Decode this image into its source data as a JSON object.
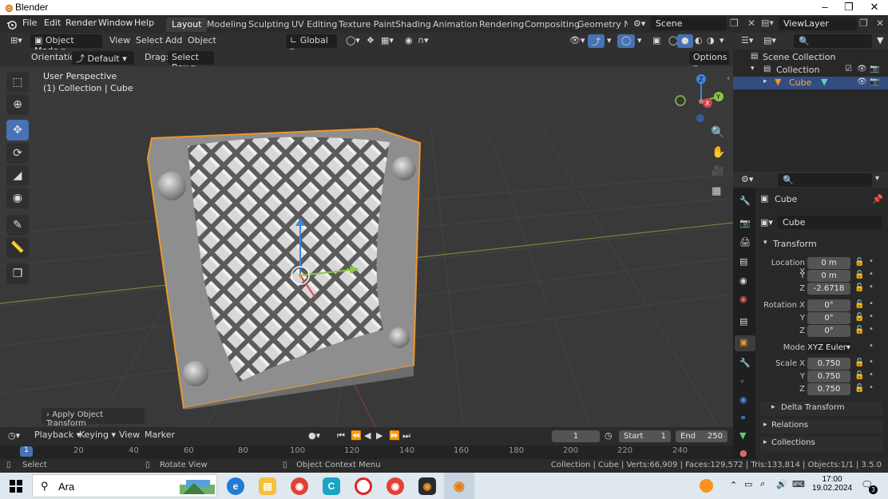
{
  "window": {
    "title": "Blender"
  },
  "menu": {
    "items": [
      "File",
      "Edit",
      "Render",
      "Window",
      "Help"
    ]
  },
  "workspaces": {
    "tabs": [
      "Layout",
      "Modeling",
      "Sculpting",
      "UV Editing",
      "Texture Paint",
      "Shading",
      "Animation",
      "Rendering",
      "Compositing",
      "Geometry Noc"
    ],
    "active": "Layout"
  },
  "scene": {
    "label": "Scene",
    "view_layer": "ViewLayer"
  },
  "viewport_header": {
    "mode": "Object Mode",
    "menus": [
      "View",
      "Select",
      "Add",
      "Object"
    ],
    "transform_orientation": "Global",
    "orientation_label": "Orientation:",
    "orientation_value": "Default",
    "drag_label": "Drag:",
    "drag_value": "Select Box",
    "options_label": "Options"
  },
  "viewport": {
    "perspective_label": "User Perspective",
    "collection_label": "(1) Collection | Cube",
    "gizmo_axes": [
      "X",
      "Y",
      "Z"
    ],
    "operator_panel": "Apply Object Transform"
  },
  "outliner": {
    "root": "Scene Collection",
    "collection": "Collection",
    "object": "Cube"
  },
  "properties": {
    "object_name": "Cube",
    "data_name": "Cube",
    "transform_header": "Transform",
    "location": {
      "label_x": "Location X",
      "x": "0 m",
      "y": "0 m",
      "z": "-2.6718"
    },
    "rotation": {
      "label_x": "Rotation X",
      "x": "0°",
      "y": "0°",
      "z": "0°"
    },
    "mode_label": "Mode",
    "mode_value": "XYZ Euler",
    "scale": {
      "label_x": "Scale X",
      "x": "0.750",
      "y": "0.750",
      "z": "0.750"
    },
    "axis_labels": {
      "y": "Y",
      "z": "Z"
    },
    "delta_transform": "Delta Transform",
    "relations": "Relations",
    "collections": "Collections"
  },
  "timeline": {
    "menus": [
      "Playback",
      "Keying",
      "View",
      "Marker"
    ],
    "current_frame": "1",
    "start_label": "Start",
    "start": "1",
    "end_label": "End",
    "end": "250",
    "ruler": [
      "1",
      "20",
      "40",
      "60",
      "80",
      "100",
      "120",
      "140",
      "160",
      "180",
      "200",
      "220",
      "240"
    ]
  },
  "statusbar": {
    "select": "Select",
    "rotate": "Rotate View",
    "context_menu": "Object Context Menu",
    "stats": "Collection | Cube | Verts:66,909 | Faces:129,572 | Tris:133,814 | Objects:1/1 | 3.5.0"
  },
  "taskbar": {
    "search_label": "Ara",
    "time": "17:00",
    "date": "19.02.2024",
    "notification_count": "3"
  },
  "colors": {
    "accent": "#4772b3",
    "selected_outline": "#f0962d",
    "x_axis": "#d8404f",
    "y_axis": "#8ac642",
    "z_axis": "#3f86e0"
  }
}
